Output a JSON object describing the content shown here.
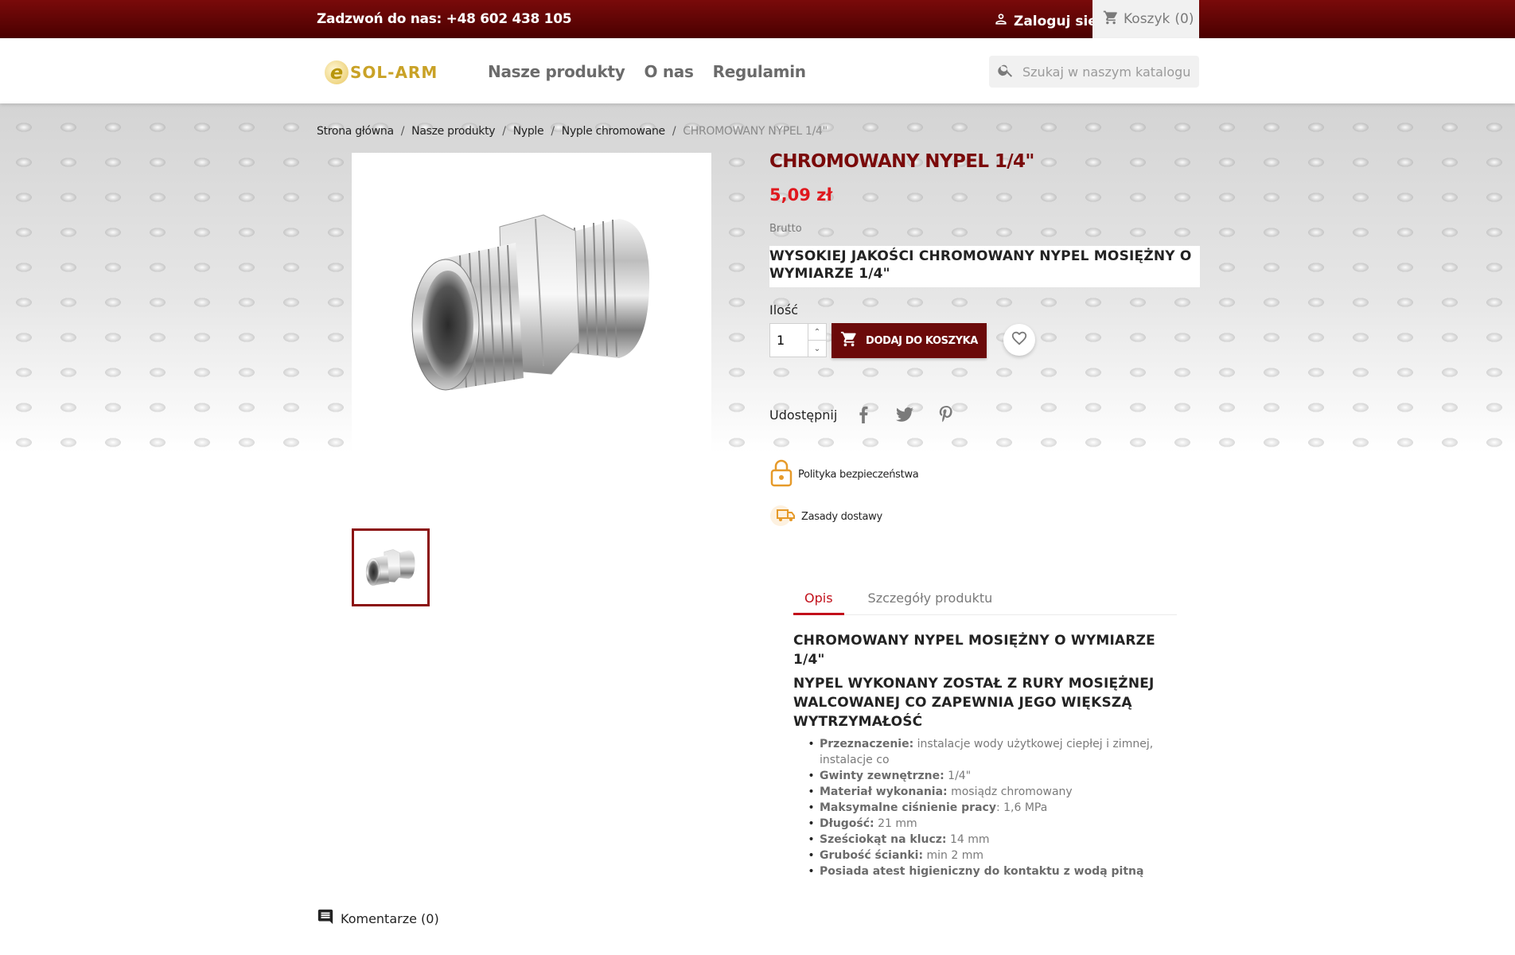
{
  "topbar": {
    "phone": "Zadzwoń do nas: +48 602 438 105",
    "login_label": "Zaloguj się",
    "cart_label": "Koszyk",
    "cart_count": "(0)"
  },
  "header": {
    "logo_letter": "e",
    "logo_text": "SOL-ARM",
    "nav": [
      "Nasze produkty",
      "O nas",
      "Regulamin"
    ],
    "search_placeholder": "Szukaj w naszym katalogu"
  },
  "breadcrumb": [
    "Strona główna",
    "Nasze produkty",
    "Nyple",
    "Nyple chromowane",
    "CHROMOWANY NYPEL 1/4\""
  ],
  "product": {
    "title": "CHROMOWANY NYPEL 1/4\"",
    "price": "5,09 zł",
    "tax_label": "Brutto",
    "short_description": "WYSOKIEJ JAKOŚCI CHROMOWANY NYPEL MOSIĘŻNY O WYMIARZE 1/4\"",
    "qty_label": "Ilość",
    "qty_value": "1",
    "add_to_cart": "DODAJ DO KOSZYKA",
    "share_label": "Udostępnij"
  },
  "reassurance": [
    "Polityka bezpieczeństwa",
    "Zasady dostawy"
  ],
  "tabs": [
    "Opis",
    "Szczegóły produktu"
  ],
  "description": {
    "heading1": "CHROMOWANY NYPEL MOSIĘŻNY O WYMIARZE 1/4\"",
    "heading2": "NYPEL WYKONANY ZOSTAŁ Z RURY MOSIĘŻNEJ WALCOWANEJ CO ZAPEWNIA JEGO WIĘKSZĄ WYTRZYMAŁOŚĆ",
    "specs": [
      {
        "key": "Przeznaczenie:",
        "value": " instalacje wody użytkowej ciepłej i zimnej, instalacje co"
      },
      {
        "key": "Gwinty zewnętrzne:",
        "value": " 1/4\""
      },
      {
        "key": "Materiał wykonania:",
        "value": " mosiądz chromowany"
      },
      {
        "key": "Maksymalne ciśnienie pracy",
        "value": ": 1,6 MPa"
      },
      {
        "key": "Długość:",
        "value": " 21 mm"
      },
      {
        "key": "Sześciokąt na klucz:",
        "value": " 14 mm"
      },
      {
        "key": "Grubość ścianki:",
        "value": " min 2 mm"
      },
      {
        "key": "Posiada atest higieniczny do kontaktu z wodą pitną",
        "value": ""
      }
    ]
  },
  "comments_label": "Komentarze (0)",
  "colors": {
    "brand": "#6b0a0a",
    "price": "#e0181e",
    "tab_active": "#c2101a"
  }
}
